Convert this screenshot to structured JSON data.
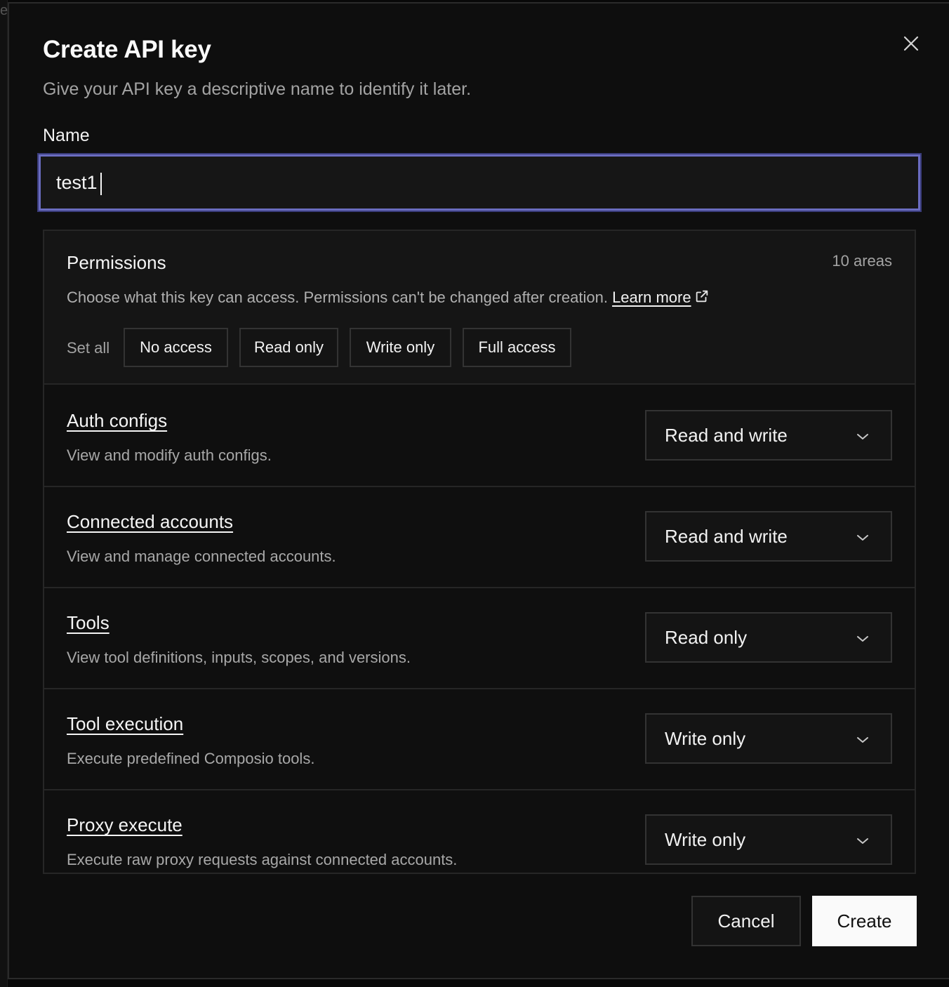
{
  "backdrop": {
    "glyph": "e"
  },
  "dialog": {
    "title": "Create API key",
    "subtitle": "Give your API key a descriptive name to identify it later.",
    "close_icon": "close-icon"
  },
  "name_field": {
    "label": "Name",
    "value": "test1"
  },
  "permissions": {
    "title": "Permissions",
    "count": "10 areas",
    "description": "Choose what this key can access. Permissions can't be changed after creation.",
    "learn_more": "Learn more",
    "learn_more_icon": "external-link-icon",
    "set_all": {
      "label": "Set all",
      "options": [
        "No access",
        "Read only",
        "Write only",
        "Full access"
      ]
    },
    "areas": [
      {
        "title": "Auth configs",
        "description": "View and modify auth configs.",
        "value": "Read and write"
      },
      {
        "title": "Connected accounts",
        "description": "View and manage connected accounts.",
        "value": "Read and write"
      },
      {
        "title": "Tools",
        "description": "View tool definitions, inputs, scopes, and versions.",
        "value": "Read only"
      },
      {
        "title": "Tool execution",
        "description": "Execute predefined Composio tools.",
        "value": "Write only"
      },
      {
        "title": "Proxy execute",
        "description": "Execute raw proxy requests against connected accounts.",
        "value": "Write only"
      }
    ]
  },
  "footer": {
    "cancel": "Cancel",
    "create": "Create"
  },
  "colors": {
    "accent_focus": "#6a6cc0",
    "background": "#0e0e0e",
    "primary_button": "#fafafa"
  }
}
